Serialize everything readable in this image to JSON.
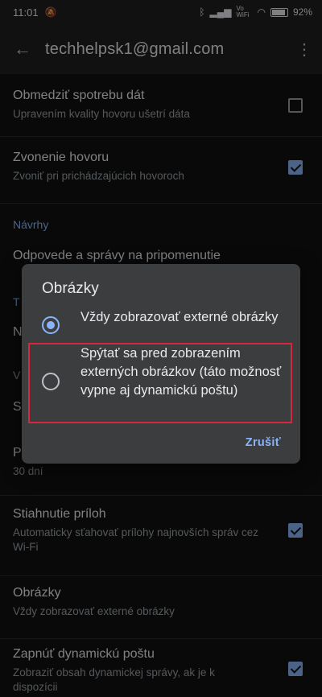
{
  "status": {
    "time": "11:01",
    "battery": "92%",
    "network": "Vo WiFi"
  },
  "appbar": {
    "title": "techhelpsk1@gmail.com"
  },
  "settings": {
    "limit_data": {
      "title": "Obmedziť spotrebu dát",
      "subtitle": "Upravením kvality hovoru ušetrí dáta",
      "checked": false
    },
    "ringing": {
      "title": "Zvonenie hovoru",
      "subtitle": "Zvoniť pri prichádzajúcich hovoroch",
      "checked": true
    },
    "section_suggestions": "Návrhy",
    "reminders": {
      "title": "Odpovede a správy na pripomenutie"
    },
    "partial_t": "T",
    "partial_n": "N",
    "partial_v": "V",
    "partial_s": "S",
    "partial_p": "P",
    "period": {
      "subtitle": "30 dní"
    },
    "attachments": {
      "title": "Stiahnutie príloh",
      "subtitle": "Automaticky sťahovať prílohy najnovších správ cez Wi-Fi",
      "checked": true
    },
    "images": {
      "title": "Obrázky",
      "subtitle": "Vždy zobrazovať externé obrázky"
    },
    "dynamic_mail": {
      "title": "Zapnúť dynamickú poštu",
      "subtitle": "Zobraziť obsah dynamickej správy, ak je k dispozícii",
      "checked": true
    }
  },
  "dialog": {
    "title": "Obrázky",
    "options": [
      {
        "label": "Vždy zobrazovať externé obrázky",
        "selected": true
      },
      {
        "label": "Spýtať sa pred zobrazením externých obrázkov (táto možnosť vypne aj dynamickú poštu)",
        "selected": false
      }
    ],
    "cancel": "Zrušiť"
  },
  "colors": {
    "accent": "#8ab4f8",
    "highlight": "#d6283d",
    "dialog_bg": "#3c3d3f"
  }
}
